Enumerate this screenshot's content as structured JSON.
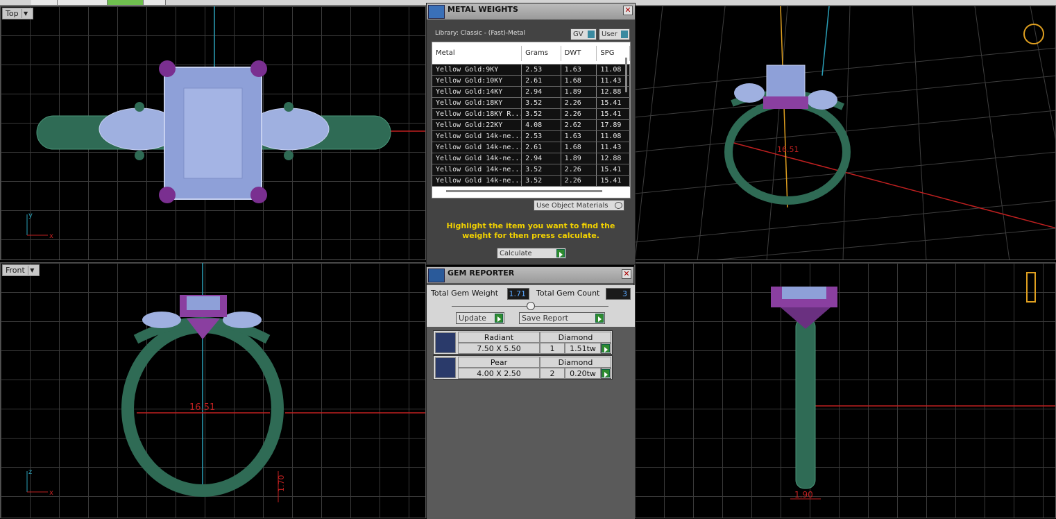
{
  "viewports": {
    "top": {
      "label": "Top",
      "axis_v": "y",
      "axis_h": "x"
    },
    "front": {
      "label": "Front",
      "axis_v": "z",
      "axis_h": "x",
      "dim_diameter": "16.51",
      "dim_height": "1.70"
    },
    "perspective": {
      "dim_diameter": "16.51"
    },
    "right": {
      "dim_width": "1.90"
    }
  },
  "metal_weights": {
    "title": "METAL WEIGHTS",
    "library": "Library: Classic - (Fast)-Metal",
    "gv_label": "GV",
    "user_label": "User",
    "columns": [
      "Metal",
      "Grams",
      "DWT",
      "SPG"
    ],
    "rows": [
      {
        "metal": "Yellow Gold:9KY",
        "grams": "2.53",
        "dwt": "1.63",
        "spg": "11.08"
      },
      {
        "metal": "Yellow Gold:10KY",
        "grams": "2.61",
        "dwt": "1.68",
        "spg": "11.43"
      },
      {
        "metal": "Yellow Gold:14KY",
        "grams": "2.94",
        "dwt": "1.89",
        "spg": "12.88"
      },
      {
        "metal": "Yellow Gold:18KY",
        "grams": "3.52",
        "dwt": "2.26",
        "spg": "15.41"
      },
      {
        "metal": "Yellow Gold:18KY R...",
        "grams": "3.52",
        "dwt": "2.26",
        "spg": "15.41"
      },
      {
        "metal": "Yellow Gold:22KY",
        "grams": "4.08",
        "dwt": "2.62",
        "spg": "17.89"
      },
      {
        "metal": "Yellow Gold 14k-ne...",
        "grams": "2.53",
        "dwt": "1.63",
        "spg": "11.08"
      },
      {
        "metal": "Yellow Gold 14k-ne...",
        "grams": "2.61",
        "dwt": "1.68",
        "spg": "11.43"
      },
      {
        "metal": "Yellow Gold 14k-ne...",
        "grams": "2.94",
        "dwt": "1.89",
        "spg": "12.88"
      },
      {
        "metal": "Yellow Gold 14k-ne...",
        "grams": "3.52",
        "dwt": "2.26",
        "spg": "15.41"
      },
      {
        "metal": "Yellow Gold 14k-ne...",
        "grams": "3.52",
        "dwt": "2.26",
        "spg": "15.41"
      }
    ],
    "use_object_materials": "Use Object Materials",
    "hint": "Highlight the item you want to find the weight for then press calculate.",
    "calculate": "Calculate"
  },
  "gem_reporter": {
    "title": "GEM REPORTER",
    "total_weight_label": "Total Gem Weight",
    "total_weight": "1.71",
    "total_count_label": "Total Gem Count",
    "total_count": "3",
    "update": "Update",
    "save_report": "Save Report",
    "gems": [
      {
        "cut": "Radiant",
        "type": "Diamond",
        "size": "7.50 X 5.50",
        "count": "1",
        "weight": "1.51tw"
      },
      {
        "cut": "Pear",
        "type": "Diamond",
        "size": "4.00 X 2.50",
        "count": "2",
        "weight": "0.20tw"
      }
    ]
  },
  "colors": {
    "metal": "#2f6b55",
    "prong": "#8a3fa0",
    "gem": "#9fb0e0",
    "grid": "#3a3a3a",
    "accent": "#f2d200"
  }
}
